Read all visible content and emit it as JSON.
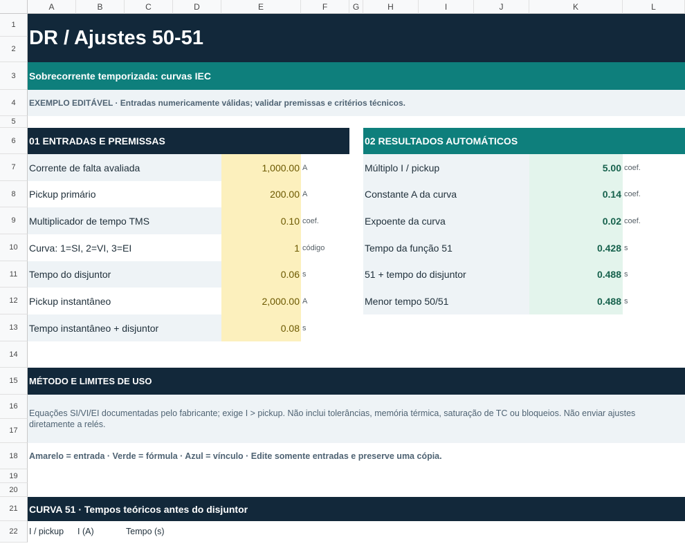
{
  "columns": [
    "A",
    "B",
    "C",
    "D",
    "E",
    "F",
    "G",
    "H",
    "I",
    "J",
    "K",
    "L"
  ],
  "rows": [
    "1",
    "2",
    "3",
    "4",
    "5",
    "6",
    "7",
    "8",
    "9",
    "10",
    "11",
    "12",
    "13",
    "14",
    "15",
    "16",
    "17",
    "18",
    "19",
    "20",
    "21",
    "22"
  ],
  "title": "DR  /  Ajustes 50-51",
  "subtitle": "Sobrecorrente temporizada: curvas IEC",
  "note": "EXEMPLO EDITÁVEL · Entradas numericamente válidas; validar premissas e critérios técnicos.",
  "inputs": {
    "header": "01  ENTRADAS E PREMISSAS",
    "items": [
      {
        "label": "Corrente de falta avaliada",
        "value": "1,000.00",
        "unit": "A"
      },
      {
        "label": "Pickup primário",
        "value": "200.00",
        "unit": "A"
      },
      {
        "label": "Multiplicador de tempo TMS",
        "value": "0.10",
        "unit": "coef."
      },
      {
        "label": "Curva: 1=SI, 2=VI, 3=EI",
        "value": "1",
        "unit": "código"
      },
      {
        "label": "Tempo do disjuntor",
        "value": "0.06",
        "unit": "s"
      },
      {
        "label": "Pickup instantâneo",
        "value": "2,000.00",
        "unit": "A"
      },
      {
        "label": "Tempo instantâneo + disjuntor",
        "value": "0.08",
        "unit": "s"
      }
    ]
  },
  "results": {
    "header": "02  RESULTADOS AUTOMÁTICOS",
    "items": [
      {
        "label": "Múltiplo I / pickup",
        "value": "5.00",
        "unit": "coef."
      },
      {
        "label": "Constante A da curva",
        "value": "0.14",
        "unit": "coef."
      },
      {
        "label": "Expoente da curva",
        "value": "0.02",
        "unit": "coef."
      },
      {
        "label": "Tempo da função 51",
        "value": "0.428",
        "unit": "s"
      },
      {
        "label": "51 + tempo do disjuntor",
        "value": "0.488",
        "unit": "s"
      },
      {
        "label": "Menor tempo 50/51",
        "value": "0.488",
        "unit": "s"
      }
    ]
  },
  "method": {
    "header": "MÉTODO E LIMITES DE USO",
    "text": "Equações SI/VI/EI documentadas pelo fabricante; exige I > pickup. Não inclui tolerâncias, memória térmica, saturação de TC ou bloqueios. Não enviar ajustes diretamente a relés.",
    "legend": "Amarelo = entrada · Verde = fórmula · Azul = vínculo · Edite somente entradas e preserve uma cópia."
  },
  "curve": {
    "header": "CURVA 51 · Tempos teóricos antes do disjuntor",
    "col1": "I / pickup",
    "col2": "I (A)",
    "col3": "Tempo (s)"
  },
  "colors": {
    "navy": "#12283a",
    "teal": "#0e7f7c",
    "input_fill": "#fcf0bd",
    "formula_fill": "#e3f4ec"
  }
}
